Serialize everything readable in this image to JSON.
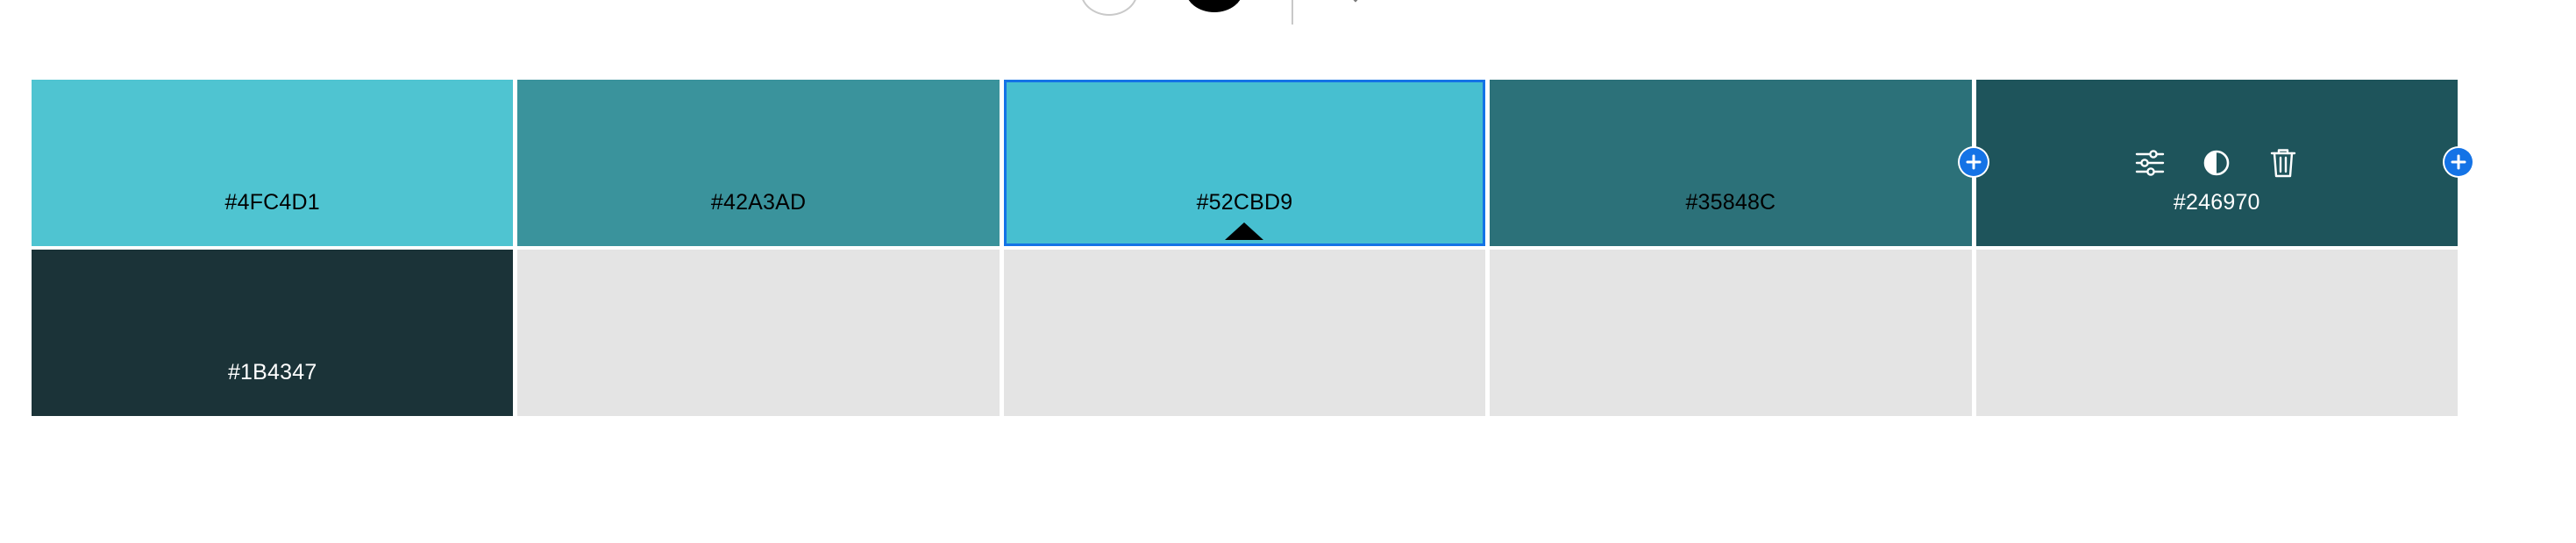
{
  "toolbar": {
    "icons": [
      "white-color-circle",
      "black-color-circle",
      "divider",
      "chevron"
    ]
  },
  "palette": {
    "rows": [
      [
        {
          "hex": "#4FC4D1",
          "color": "#4FC4D1",
          "text_color": "#000000",
          "state": "normal"
        },
        {
          "hex": "#42A3AD",
          "color": "#3A939C",
          "text_color": "#000000",
          "state": "normal"
        },
        {
          "hex": "#52CBD9",
          "color": "#47BFD0",
          "text_color": "#000000",
          "state": "selected"
        },
        {
          "hex": "#35848C",
          "color": "#2C7179",
          "text_color": "#000000",
          "state": "normal"
        },
        {
          "hex": "#246970",
          "color": "#1E545B",
          "text_color": "#ffffff",
          "state": "active"
        }
      ],
      [
        {
          "hex": "#1B4347",
          "color": "#1B3338",
          "text_color": "#ffffff",
          "state": "normal"
        },
        {
          "hex": "",
          "color": "#E4E4E4",
          "state": "empty"
        },
        {
          "hex": "",
          "color": "#E4E4E4",
          "state": "empty"
        },
        {
          "hex": "",
          "color": "#E4E4E4",
          "state": "empty"
        },
        {
          "hex": "",
          "color": "#E4E4E4",
          "state": "empty"
        }
      ]
    ],
    "active_cell_actions": [
      "adjust-sliders-icon",
      "contrast-icon",
      "trash-icon"
    ],
    "add_buttons": [
      "add-color-before",
      "add-color-after"
    ],
    "selection_accent": "#1473E6"
  }
}
